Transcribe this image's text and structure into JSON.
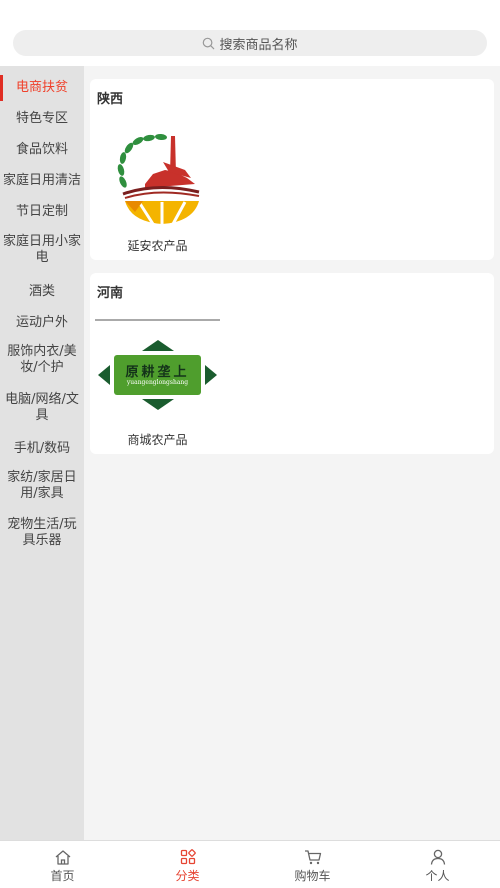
{
  "search": {
    "placeholder": "搜索商品名称",
    "icon": "search-icon"
  },
  "sidebar": {
    "active_index": 0,
    "items": [
      {
        "label": "电商扶贫"
      },
      {
        "label": "特色专区"
      },
      {
        "label": "食品饮料"
      },
      {
        "label": "家庭日用清洁"
      },
      {
        "label": "节日定制"
      },
      {
        "label": "家庭日用小家电"
      },
      {
        "label": "酒类"
      },
      {
        "label": "运动户外"
      },
      {
        "label": "服饰内衣/美妆/个护"
      },
      {
        "label": "电脑/网络/文具"
      },
      {
        "label": "手机/数码"
      },
      {
        "label": "家纺/家居日用/家具"
      },
      {
        "label": "宠物生活/玩具乐器"
      }
    ]
  },
  "sections": [
    {
      "title": "陕西",
      "products": [
        {
          "name": "延安农产品"
        }
      ]
    },
    {
      "title": "河南",
      "products": [
        {
          "name": "商城农产品",
          "logo_text": "原耕垄上",
          "logo_subtext": "yuangenglongshang"
        }
      ]
    }
  ],
  "tabbar": {
    "active_index": 1,
    "accent_color": "#e64432",
    "items": [
      {
        "label": "首页",
        "icon": "home-icon"
      },
      {
        "label": "分类",
        "icon": "category-icon"
      },
      {
        "label": "购物车",
        "icon": "cart-icon"
      },
      {
        "label": "个人",
        "icon": "user-icon"
      }
    ]
  }
}
